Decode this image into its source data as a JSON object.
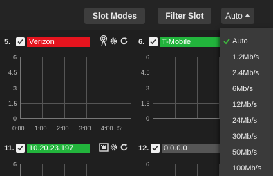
{
  "toolbar": {
    "slot_modes_label": "Slot Modes",
    "filter_slot_label": "Filter Slot",
    "bitrate_selected": "Auto"
  },
  "slots": [
    {
      "number": "5.",
      "name": "Verizon",
      "status_color": "#e5141e",
      "checked": true,
      "y_ticks": [
        "6",
        "4.5",
        "3",
        "1.5",
        "0"
      ],
      "x_ticks": [
        "0:00",
        "1:00",
        "2:00",
        "3:00",
        "4:00",
        "5:..."
      ]
    },
    {
      "number": "6.",
      "name": "T-Mobile",
      "status_color": "#22b43c",
      "checked": true,
      "y_ticks": [
        "6",
        "4.5",
        "3",
        "1.5",
        "0"
      ]
    },
    {
      "number": "11.",
      "name": "10.20.23.197",
      "status_color": "#22b43c",
      "checked": true,
      "y_ticks": [
        "6"
      ]
    },
    {
      "number": "12.",
      "name": "0.0.0.0",
      "status_color": "#555555",
      "checked": true,
      "y_ticks": [
        "6"
      ]
    }
  ],
  "bitrate_menu": {
    "selected": "Auto",
    "options": [
      "Auto",
      "1.2Mb/s",
      "2.4Mb/s",
      "6Mb/s",
      "12Mb/s",
      "24Mb/s",
      "30Mb/s",
      "50Mb/s",
      "100Mb/s"
    ]
  }
}
